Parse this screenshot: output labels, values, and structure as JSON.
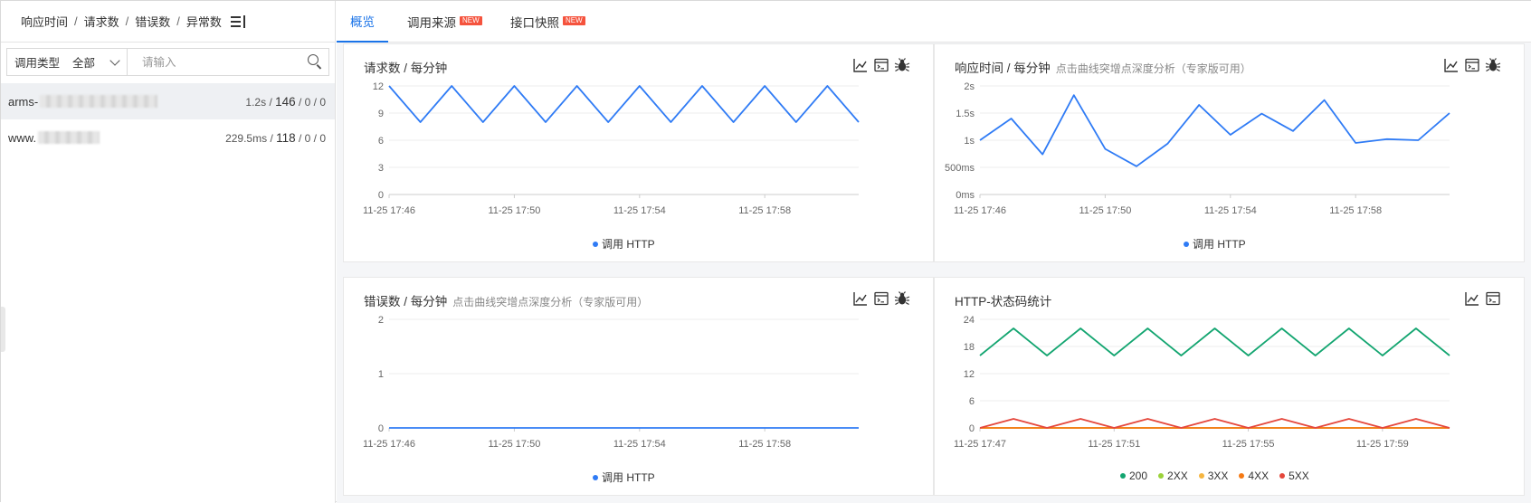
{
  "left": {
    "sort_items": [
      "响应时间",
      "请求数",
      "错误数",
      "异常数"
    ],
    "separator": "/",
    "filter": {
      "type_label": "调用类型",
      "type_value": "全部",
      "search_placeholder": "请输入"
    },
    "services": [
      {
        "name": "arms-",
        "stats_prefix": "1.2s / ",
        "stats_big": "146",
        "stats_suffix": " / 0 / 0",
        "selected": true
      },
      {
        "name": "www.",
        "stats_prefix": "229.5ms / ",
        "stats_big": "118",
        "stats_suffix": " / 0 / 0",
        "selected": false
      }
    ]
  },
  "tabs": [
    {
      "label": "概览",
      "active": true,
      "badge": ""
    },
    {
      "label": "调用来源",
      "active": false,
      "badge": "NEW"
    },
    {
      "label": "接口快照",
      "active": false,
      "badge": "NEW"
    }
  ],
  "colors": {
    "accent": "#1a73e8",
    "series_http": "#2f7bf5",
    "s200": "#13a570",
    "s2xx": "#9bd23a",
    "s3xx": "#f5b541",
    "s4xx": "#f57a14",
    "s5xx": "#e5473c"
  },
  "charts": [
    {
      "title": "请求数 / 每分钟",
      "subtitle": "",
      "tools": [
        "line-chart-icon",
        "terminal-icon",
        "bug-icon"
      ],
      "chart_data": {
        "type": "line",
        "x": [
          "11-25 17:46",
          "11-25 17:47",
          "11-25 17:48",
          "11-25 17:49",
          "11-25 17:50",
          "11-25 17:51",
          "11-25 17:52",
          "11-25 17:53",
          "11-25 17:54",
          "11-25 17:55",
          "11-25 17:56",
          "11-25 17:57",
          "11-25 17:58",
          "11-25 17:59",
          "11-25 18:00",
          "11-25 18:01"
        ],
        "x_ticks": [
          "11-25 17:46",
          "11-25 17:50",
          "11-25 17:54",
          "11-25 17:58"
        ],
        "y_ticks": [
          "0",
          "3",
          "6",
          "9",
          "12"
        ],
        "ylim": [
          0,
          12
        ],
        "series": [
          {
            "name": "调用 HTTP",
            "color": "#2f7bf5",
            "values": [
              12,
              8,
              12,
              8,
              12,
              8,
              12,
              8,
              12,
              8,
              12,
              8,
              12,
              8,
              12,
              8
            ]
          }
        ],
        "legend": "bottom-center"
      }
    },
    {
      "title": "响应时间 / 每分钟",
      "subtitle": "点击曲线突增点深度分析（专家版可用）",
      "tools": [
        "line-chart-icon",
        "terminal-icon",
        "bug-icon"
      ],
      "chart_data": {
        "type": "line",
        "x": [
          "11-25 17:46",
          "11-25 17:47",
          "11-25 17:48",
          "11-25 17:49",
          "11-25 17:50",
          "11-25 17:51",
          "11-25 17:52",
          "11-25 17:53",
          "11-25 17:54",
          "11-25 17:55",
          "11-25 17:56",
          "11-25 17:57",
          "11-25 17:58",
          "11-25 17:59",
          "11-25 18:00",
          "11-25 18:01"
        ],
        "x_ticks": [
          "11-25 17:46",
          "11-25 17:50",
          "11-25 17:54",
          "11-25 17:58"
        ],
        "y_ticks": [
          "0ms",
          "500ms",
          "1s",
          "1.5s",
          "2s"
        ],
        "ylim": [
          0,
          2000
        ],
        "series": [
          {
            "name": "调用 HTTP",
            "color": "#2f7bf5",
            "values": [
              1000,
              1400,
              740,
              1830,
              840,
              520,
              940,
              1650,
              1100,
              1490,
              1170,
              1740,
              950,
              1020,
              1000,
              1500
            ]
          }
        ],
        "legend": "bottom-center"
      }
    },
    {
      "title": "错误数 / 每分钟",
      "subtitle": "点击曲线突增点深度分析（专家版可用）",
      "tools": [
        "line-chart-icon",
        "terminal-icon",
        "bug-icon"
      ],
      "chart_data": {
        "type": "line",
        "x": [
          "11-25 17:46",
          "11-25 17:47",
          "11-25 17:48",
          "11-25 17:49",
          "11-25 17:50",
          "11-25 17:51",
          "11-25 17:52",
          "11-25 17:53",
          "11-25 17:54",
          "11-25 17:55",
          "11-25 17:56",
          "11-25 17:57",
          "11-25 17:58",
          "11-25 17:59",
          "11-25 18:00",
          "11-25 18:01"
        ],
        "x_ticks": [
          "11-25 17:46",
          "11-25 17:50",
          "11-25 17:54",
          "11-25 17:58"
        ],
        "y_ticks": [
          "0",
          "1",
          "2"
        ],
        "ylim": [
          0,
          2
        ],
        "series": [
          {
            "name": "调用 HTTP",
            "color": "#2f7bf5",
            "values": [
              0,
              0,
              0,
              0,
              0,
              0,
              0,
              0,
              0,
              0,
              0,
              0,
              0,
              0,
              0,
              0
            ]
          }
        ],
        "legend": "bottom-center"
      }
    },
    {
      "title": "HTTP-状态码统计",
      "subtitle": "",
      "tools": [
        "line-chart-icon",
        "terminal-icon"
      ],
      "chart_data": {
        "type": "line",
        "x": [
          "11-25 17:47",
          "11-25 17:48",
          "11-25 17:49",
          "11-25 17:50",
          "11-25 17:51",
          "11-25 17:52",
          "11-25 17:53",
          "11-25 17:54",
          "11-25 17:55",
          "11-25 17:56",
          "11-25 17:57",
          "11-25 17:58",
          "11-25 17:59",
          "11-25 18:00",
          "11-25 18:01"
        ],
        "x_ticks": [
          "11-25 17:47",
          "11-25 17:51",
          "11-25 17:55",
          "11-25 17:59"
        ],
        "y_ticks": [
          "0",
          "6",
          "12",
          "18",
          "24"
        ],
        "ylim": [
          0,
          24
        ],
        "series": [
          {
            "name": "200",
            "color": "#13a570",
            "values": [
              16,
              22,
              16,
              22,
              16,
              22,
              16,
              22,
              16,
              22,
              16,
              22,
              16,
              22,
              16
            ]
          },
          {
            "name": "2XX",
            "color": "#9bd23a",
            "values": [
              0,
              0,
              0,
              0,
              0,
              0,
              0,
              0,
              0,
              0,
              0,
              0,
              0,
              0,
              0
            ]
          },
          {
            "name": "3XX",
            "color": "#f5b541",
            "values": [
              0,
              0,
              0,
              0,
              0,
              0,
              0,
              0,
              0,
              0,
              0,
              0,
              0,
              0,
              0
            ]
          },
          {
            "name": "4XX",
            "color": "#f57a14",
            "values": [
              0,
              0,
              0,
              0,
              0,
              0,
              0,
              0,
              0,
              0,
              0,
              0,
              0,
              0,
              0
            ]
          },
          {
            "name": "5XX",
            "color": "#e5473c",
            "values": [
              0,
              2,
              0,
              2,
              0,
              2,
              0,
              2,
              0,
              2,
              0,
              2,
              0,
              2,
              0
            ]
          }
        ],
        "legend": "bottom-center"
      }
    }
  ]
}
